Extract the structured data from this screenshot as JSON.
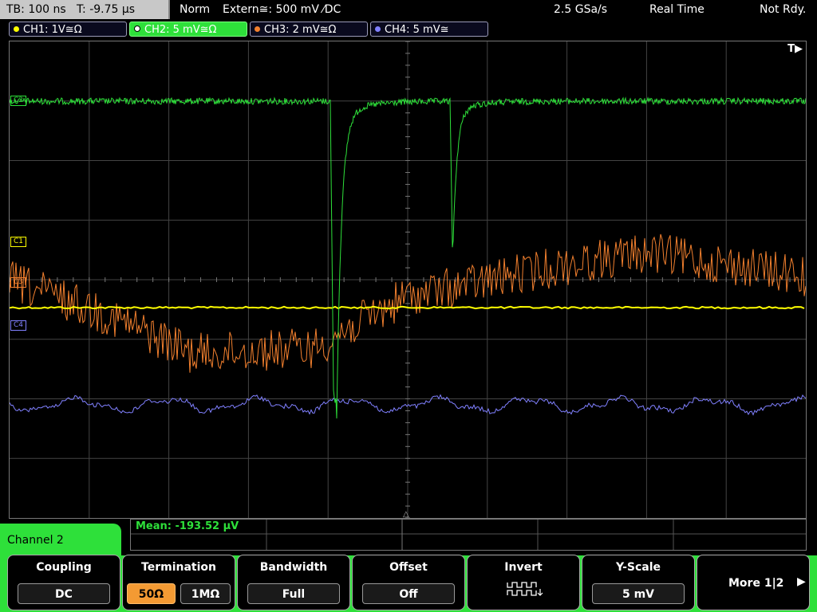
{
  "status": {
    "timebase": "TB: 100 ns",
    "trigger_time": "T: -9.75 µs",
    "mode": "Norm",
    "trigger_source": "Extern≅: 500 mV ⁄DC",
    "sample_rate": "2.5 GSa/s",
    "acq_mode": "Real Time",
    "ready_state": "Not Rdy."
  },
  "channels": [
    {
      "id": "ch1",
      "label": "CH1: 1V≅Ω",
      "color": "#ffff00"
    },
    {
      "id": "ch2",
      "label": "CH2: 5 mV≅Ω",
      "color": "#2ee03a"
    },
    {
      "id": "ch3",
      "label": "CH3: 2 mV≅Ω",
      "color": "#f3802e"
    },
    {
      "id": "ch4",
      "label": "CH4: 5 mV≅",
      "color": "#8080ff"
    }
  ],
  "markers": {
    "c1": "C1",
    "c2": "C2",
    "c3": "C3",
    "c4": "C4",
    "trigger_indicator": "T▶"
  },
  "measurement": {
    "mean": "Mean: -193.52 µV"
  },
  "menu": {
    "title": "Channel 2",
    "coupling": {
      "title": "Coupling",
      "value": "DC"
    },
    "termination": {
      "title": "Termination",
      "option_a": "50Ω",
      "option_b": "1MΩ",
      "selected": "50Ω"
    },
    "bandwidth": {
      "title": "Bandwidth",
      "value": "Full"
    },
    "offset": {
      "title": "Offset",
      "value": "Off"
    },
    "invert": {
      "title": "Invert"
    },
    "yscale": {
      "title": "Y-Scale",
      "value": "5 mV"
    },
    "more": {
      "label": "More 1|2"
    }
  },
  "colors": {
    "ch1": "#ffff00",
    "ch2": "#2ee03a",
    "ch3": "#f3802e",
    "ch4": "#8080ff",
    "accent": "#2ee03a"
  }
}
